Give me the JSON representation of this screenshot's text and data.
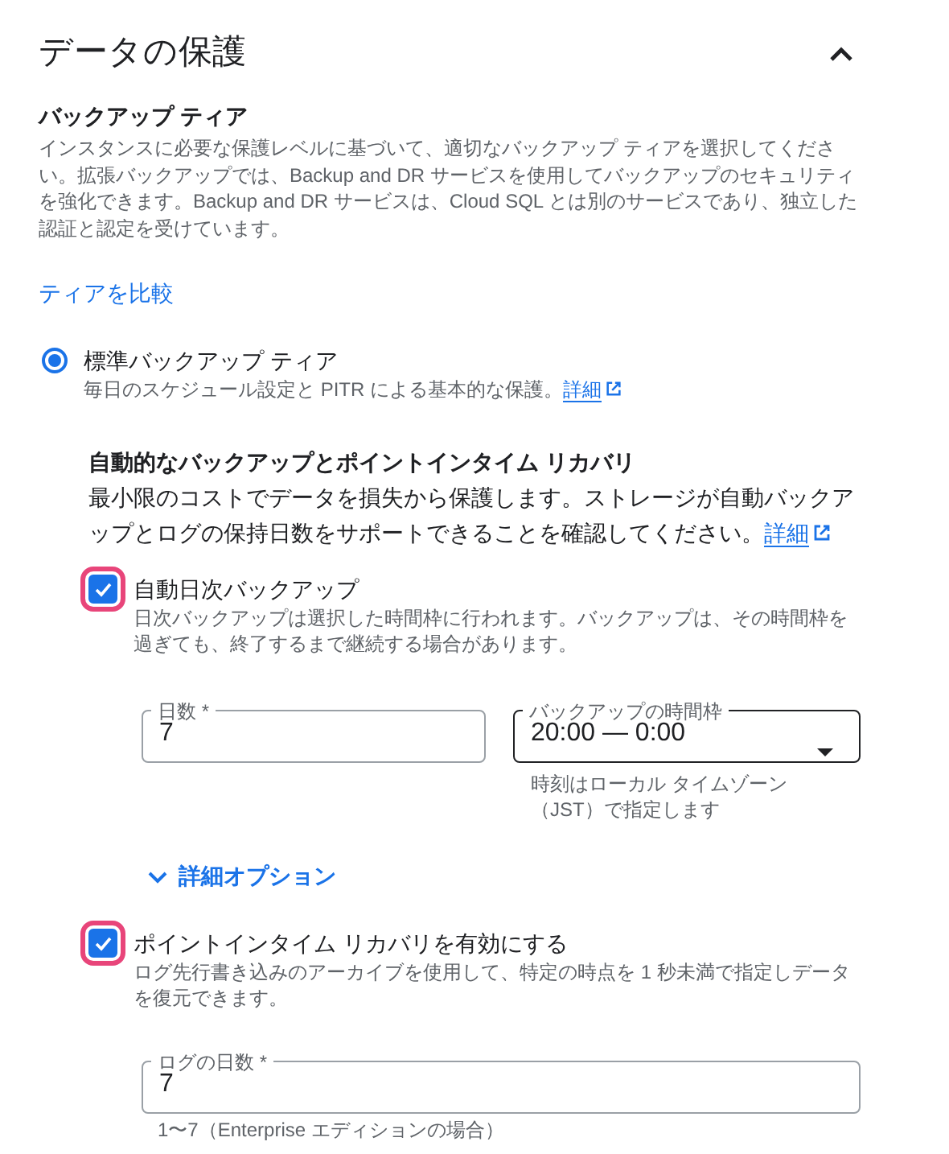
{
  "section": {
    "title": "データの保護",
    "expanded": true
  },
  "backup_tier": {
    "heading": "バックアップ ティア",
    "description": "インスタンスに必要な保護レベルに基づいて、適切なバックアップ ティアを選択してください。拡張バックアップでは、Backup and DR サービスを使用してバックアップのセキュリティを強化できます。Backup and DR サービスは、Cloud SQL とは別のサービスであり、独立した認証と認定を受けています。",
    "compare_link": "ティアを比較"
  },
  "tiers": [
    {
      "label": "標準バックアップ ティア",
      "description": "毎日のスケジュール設定と PITR による基本的な保護。",
      "link": "詳細",
      "selected": true
    }
  ],
  "automatic": {
    "heading": "自動的なバックアップとポイントインタイム リカバリ",
    "description": "最小限のコストでデータを損失から保護します。ストレージが自動バックアップとログの保持日数をサポートできることを確認してください。",
    "link": "詳細"
  },
  "daily_backup": {
    "label": "自動日次バックアップ",
    "description": "日次バックアップは選択した時間枠に行われます。バックアップは、その時間枠を過ぎても、終了するまで継続する場合があります。",
    "checked": true,
    "highlighted": true
  },
  "days_field": {
    "label": "日数 *",
    "value": "7"
  },
  "window_field": {
    "label": "バックアップの時間枠",
    "value": "20:00 — 0:00",
    "hint": "時刻はローカル タイムゾーン（JST）で指定します"
  },
  "advanced_options": {
    "label": "詳細オプション",
    "expanded": false
  },
  "pitr": {
    "label": "ポイントインタイム リカバリを有効にする",
    "description": "ログ先行書き込みのアーカイブを使用して、特定の時点を 1 秒未満で指定しデータを復元できます。",
    "checked": true,
    "highlighted": true
  },
  "log_days_field": {
    "label": "ログの日数 *",
    "value": "7",
    "hint": "1〜7（Enterprise エディションの場合）"
  }
}
